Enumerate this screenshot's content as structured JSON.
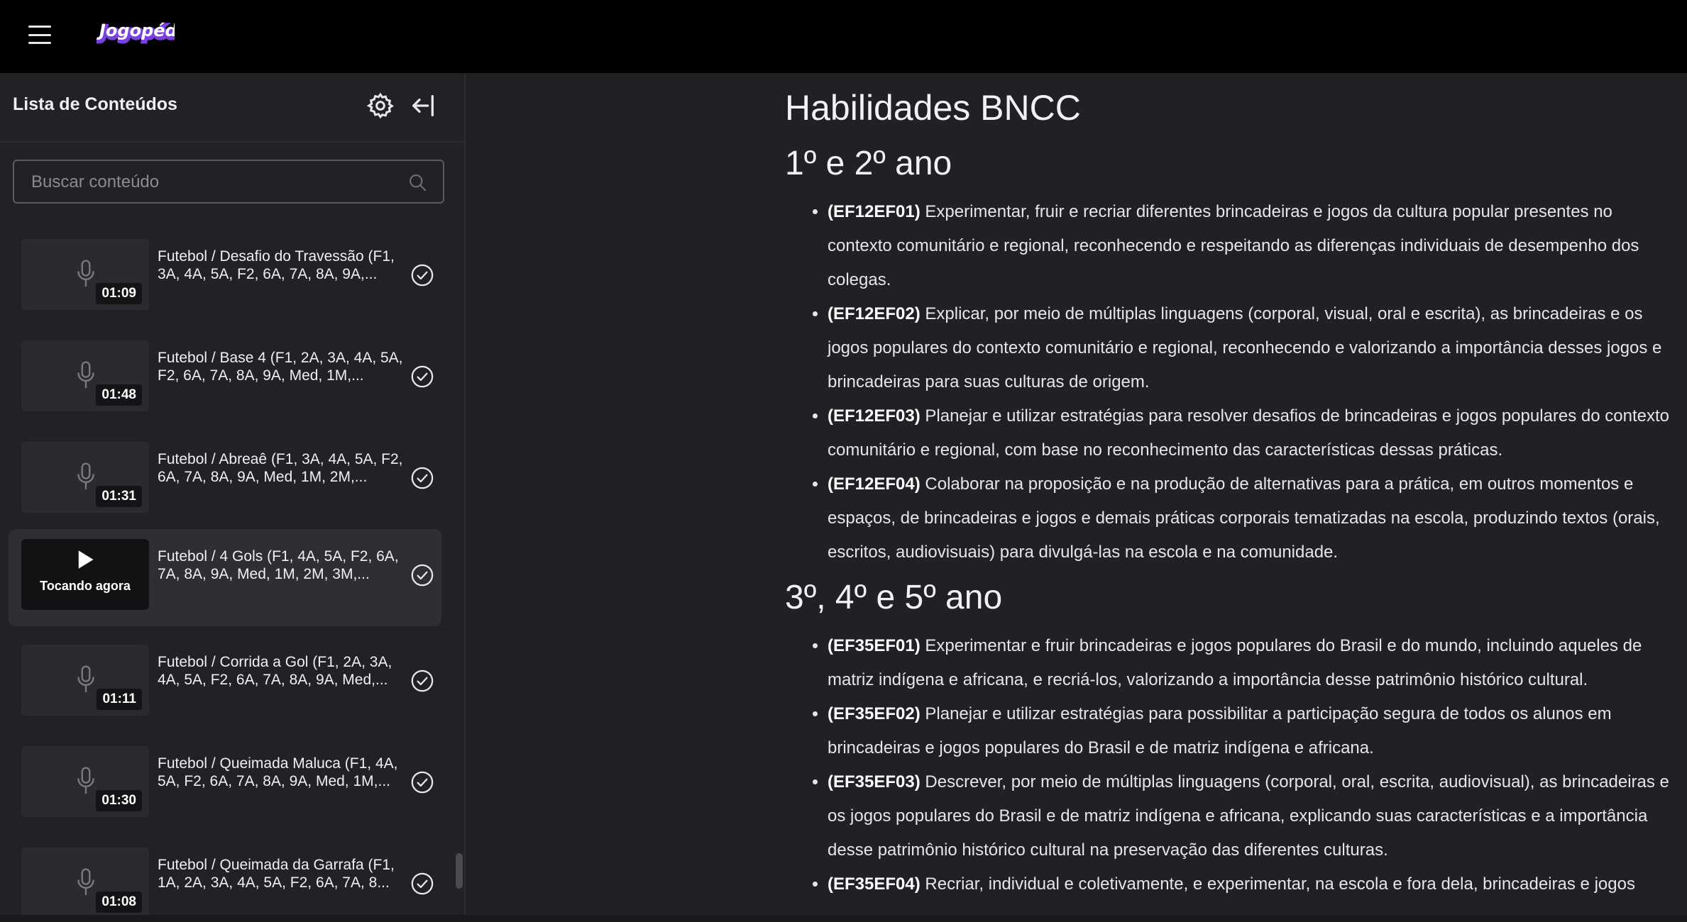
{
  "brand": {
    "logo_text": "Jogopédia",
    "accent": "#7b3fe4"
  },
  "sidebar": {
    "title": "Lista de Conteúdos",
    "search": {
      "placeholder": "Buscar conteúdo",
      "value": ""
    },
    "items": [
      {
        "title": "Futebol / Desafio do Travessão (F1, 3A, 4A, 5A, F2, 6A, 7A, 8A, 9A,...",
        "duration": "01:09",
        "playing": false
      },
      {
        "title": "Futebol / Base 4 (F1, 2A, 3A, 4A, 5A, F2, 6A, 7A, 8A, 9A, Med, 1M,...",
        "duration": "01:48",
        "playing": false
      },
      {
        "title": "Futebol / Abreaê (F1, 3A, 4A, 5A, F2, 6A, 7A, 8A, 9A, Med, 1M, 2M,...",
        "duration": "01:31",
        "playing": false
      },
      {
        "title": "Futebol / 4 Gols (F1, 4A, 5A, F2, 6A, 7A, 8A, 9A, Med, 1M, 2M, 3M,...",
        "duration": "",
        "playing": true,
        "playing_label": "Tocando agora"
      },
      {
        "title": "Futebol / Corrida a Gol (F1, 2A, 3A, 4A, 5A, F2, 6A, 7A, 8A, 9A, Med,...",
        "duration": "01:11",
        "playing": false
      },
      {
        "title": "Futebol / Queimada Maluca (F1, 4A, 5A, F2, 6A, 7A, 8A, 9A, Med, 1M,...",
        "duration": "01:30",
        "playing": false
      },
      {
        "title": "Futebol / Queimada da Garrafa (F1, 1A, 2A, 3A, 4A, 5A, F2, 6A, 7A, 8...",
        "duration": "01:08",
        "playing": false
      }
    ]
  },
  "article": {
    "title": "Habilidades BNCC",
    "sections": [
      {
        "heading": "1º e 2º ano",
        "skills": [
          {
            "code": "(EF12EF01)",
            "text": "Experimentar, fruir e recriar diferentes brincadeiras e jogos da cultura popular presentes no contexto comunitário e regional, reconhecendo e respeitando as diferenças individuais de desempenho dos colegas."
          },
          {
            "code": "(EF12EF02)",
            "text": "Explicar, por meio de múltiplas linguagens (corporal, visual, oral e escrita), as brincadeiras e os jogos populares do contexto comunitário e regional, reconhecendo e valorizando a importância desses jogos e brincadeiras para suas culturas de origem."
          },
          {
            "code": "(EF12EF03)",
            "text": "Planejar e utilizar estratégias para resolver desafios de brincadeiras e jogos populares do contexto comunitário e regional, com base no reconhecimento das características dessas práticas."
          },
          {
            "code": "(EF12EF04)",
            "text": "Colaborar na proposição e na produção de alternativas para a prática, em outros momentos e espaços, de brincadeiras e jogos e demais práticas corporais tematizadas na escola, produzindo textos (orais, escritos, audiovisuais) para divulgá-las na escola e na comunidade."
          }
        ]
      },
      {
        "heading": "3º, 4º e 5º ano",
        "skills": [
          {
            "code": "(EF35EF01)",
            "text": "Experimentar e fruir brincadeiras e jogos populares do Brasil e do mundo, incluindo aqueles de matriz indígena e africana, e recriá-los, valorizando a importância desse patrimônio histórico cultural."
          },
          {
            "code": "(EF35EF02)",
            "text": "Planejar e utilizar estratégias para possibilitar a participação segura de todos os alunos em brincadeiras e jogos populares do Brasil e de matriz indígena e africana."
          },
          {
            "code": "(EF35EF03)",
            "text": "Descrever, por meio de múltiplas linguagens (corporal, oral, escrita, audiovisual), as brincadeiras e os jogos populares do Brasil e de matriz indígena e africana, explicando suas características e a importância desse patrimônio histórico cultural na preservação das diferentes culturas."
          },
          {
            "code": "(EF35EF04)",
            "text": "Recriar, individual e coletivamente, e experimentar, na escola e fora dela, brincadeiras e jogos"
          }
        ]
      }
    ]
  }
}
